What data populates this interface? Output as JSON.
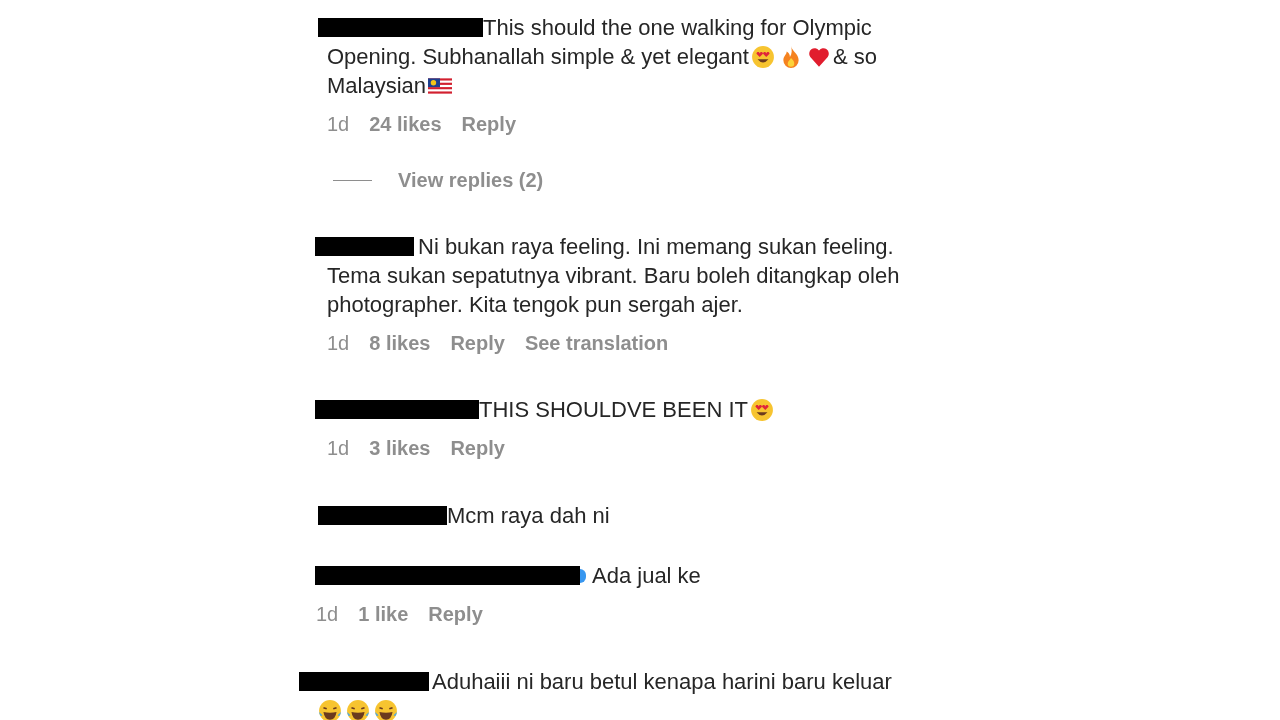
{
  "comments": [
    {
      "lines": [
        [
          "This should the one walking for Olympic"
        ],
        [
          "Opening. Subhanallah simple & yet elegant",
          "& so"
        ],
        [
          "Malaysian"
        ]
      ],
      "meta": {
        "time": "1d",
        "likes": "24 likes",
        "actions": [
          "Reply"
        ]
      },
      "view_replies": "View replies (2)"
    },
    {
      "lines": [
        [
          "Ni bukan raya feeling. Ini memang sukan feeling."
        ],
        [
          "Tema sukan sepatutnya vibrant. Baru boleh ditangkap oleh"
        ],
        [
          "photographer. Kita tengok pun sergah ajer."
        ]
      ],
      "meta": {
        "time": "1d",
        "likes": "8 likes",
        "actions": [
          "Reply",
          "See translation"
        ]
      }
    },
    {
      "lines": [
        [
          "THIS SHOULDVE BEEN IT"
        ]
      ],
      "meta": {
        "time": "1d",
        "likes": "3 likes",
        "actions": [
          "Reply"
        ]
      }
    },
    {
      "lines": [
        [
          "Mcm raya dah ni"
        ]
      ]
    },
    {
      "lines": [
        [
          "Ada jual ke"
        ]
      ],
      "meta": {
        "time": "1d",
        "likes": "1 like",
        "actions": [
          "Reply"
        ]
      }
    },
    {
      "lines": [
        [
          "Aduhaiii ni baru betul kenapa harini baru keluar"
        ]
      ]
    }
  ]
}
